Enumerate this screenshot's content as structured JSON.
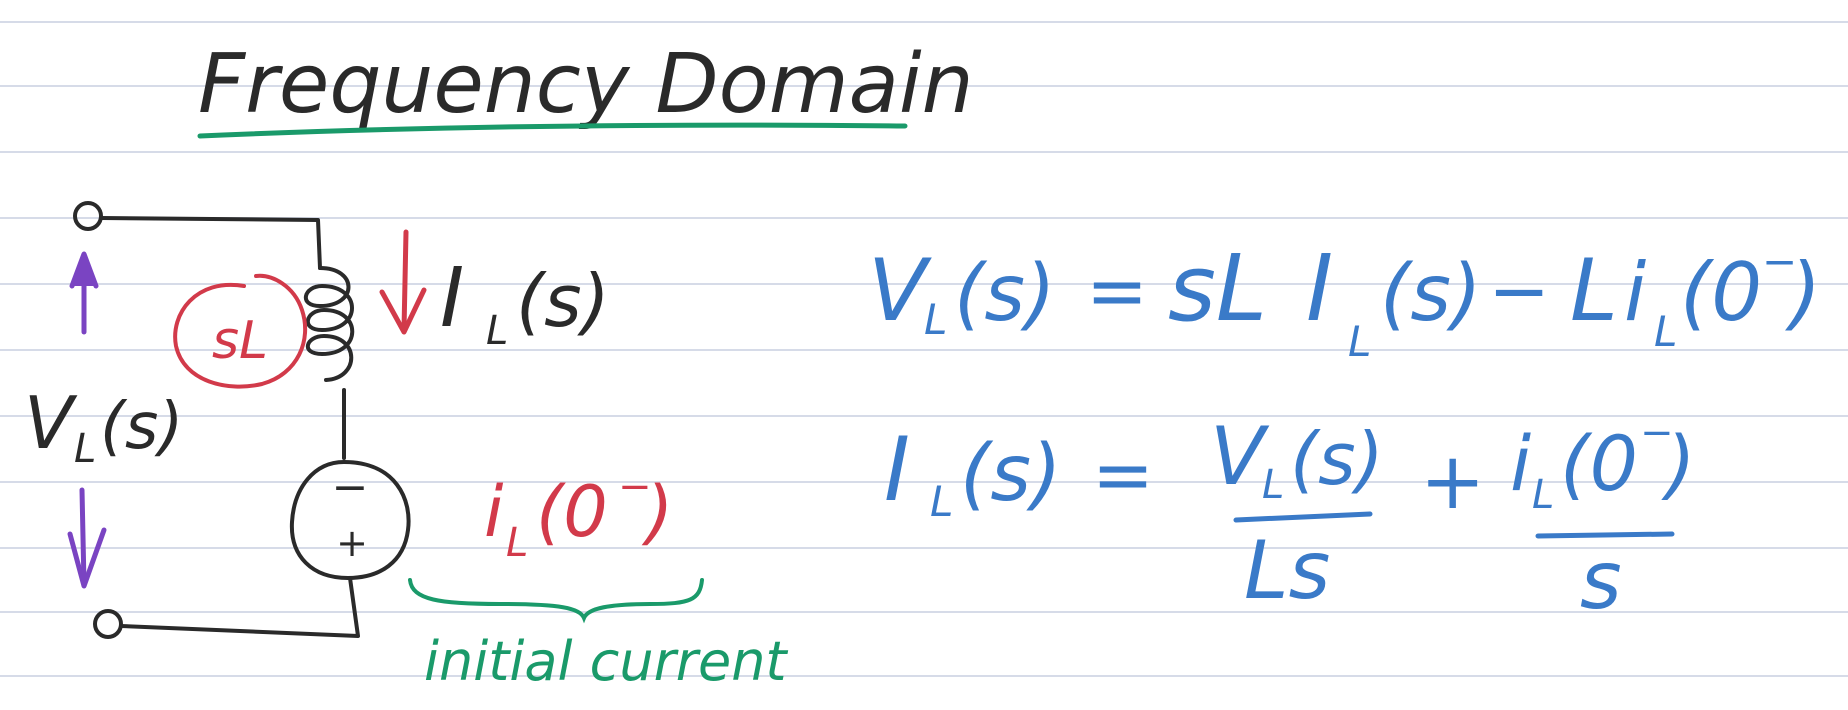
{
  "title": "Frequency Domain",
  "circuit": {
    "impedance_label": "sL",
    "current_label": "I",
    "current_sub": "L",
    "current_arg": "(s)",
    "voltage_label": "V",
    "voltage_sub": "L",
    "voltage_arg": "(s)",
    "source_top_sign": "−",
    "source_bottom_sign": "+",
    "source_value_main": "i",
    "source_value_sub": "L",
    "source_value_arg": "(0",
    "source_value_sup": "−",
    "source_value_close": ")",
    "annotation": "initial current"
  },
  "equation1": {
    "lhs_V": "V",
    "lhs_sub": "L",
    "lhs_arg": "(s)",
    "equals": "=",
    "sL": "sL",
    "I": "I",
    "I_sub": "L",
    "I_arg": "(s)",
    "minus": "−",
    "L": "L",
    "i": "i",
    "i_sub": "L",
    "i_arg": "(0",
    "i_sup": "−",
    "i_close": ")"
  },
  "equation2": {
    "lhs_I": "I",
    "lhs_sub": "L",
    "lhs_arg": "(s)",
    "equals": "=",
    "frac1_num_V": "V",
    "frac1_num_sub": "L",
    "frac1_num_arg": "(s)",
    "frac1_den": "Ls",
    "plus": "+",
    "frac2_num_i": "i",
    "frac2_num_sub": "L",
    "frac2_num_arg": "(0",
    "frac2_num_sup": "−",
    "frac2_num_close": ")",
    "frac2_den": "s"
  },
  "colors": {
    "ink_black": "#2a2a2a",
    "ink_red": "#d23a4a",
    "ink_green": "#1a9a6a",
    "ink_blue": "#3a7ac8",
    "ink_purple": "#7a44c2",
    "rule_line": "#d6dbe8"
  }
}
